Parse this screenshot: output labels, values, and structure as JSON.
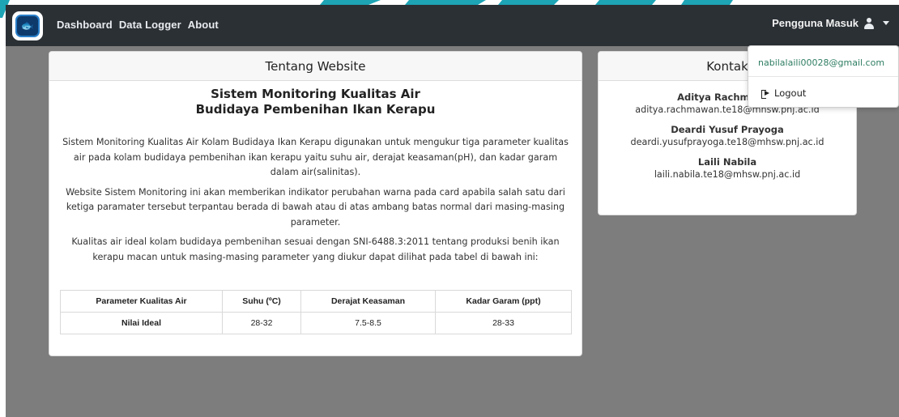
{
  "nav": {
    "items": [
      "Dashboard",
      "Data Logger",
      "About"
    ]
  },
  "user_menu": {
    "label": "Pengguna Masuk",
    "email": "nabilalaili00028@gmail.com",
    "logout": "Logout"
  },
  "about": {
    "header": "Tentang Website",
    "title_line1": "Sistem Monitoring Kualitas Air",
    "title_line2": "Budidaya Pembenihan Ikan Kerapu",
    "paragraph1": "Sistem Monitoring Kualitas Air Kolam Budidaya Ikan Kerapu digunakan untuk mengukur tiga parameter kualitas air pada kolam budidaya pembenihan ikan kerapu yaitu suhu air, derajat keasaman(pH), dan kadar garam dalam air(salinitas).",
    "paragraph2": "Website Sistem Monitoring ini akan memberikan indikator perubahan warna pada card apabila salah satu dari ketiga paramater tersebut terpantau berada di bawah atau di atas ambang batas normal dari masing-masing parameter.",
    "paragraph3": "Kualitas air ideal kolam budidaya pembenihan sesuai dengan SNI-6488.3:2011 tentang produksi benih ikan kerapu macan untuk masing-masing parameter yang diukur dapat dilihat pada tabel di bawah ini:",
    "table": {
      "headers": [
        "Parameter Kualitas Air",
        "Suhu (ºC)",
        "Derajat Keasaman",
        "Kadar Garam (ppt)"
      ],
      "row": [
        "Nilai Ideal",
        "28-32",
        "7.5-8.5",
        "28-33"
      ]
    }
  },
  "contact": {
    "header": "Kontak",
    "people": [
      {
        "name": "Aditya Rachmawan",
        "email": "aditya.rachmawan.te18@mhsw.pnj.ac.id"
      },
      {
        "name": "Deardi Yusuf Prayoga",
        "email": "deardi.yusufprayoga.te18@mhsw.pnj.ac.id"
      },
      {
        "name": "Laili Nabila",
        "email": "laili.nabila.te18@mhsw.pnj.ac.id"
      }
    ]
  },
  "colors": {
    "navbar": "#2b3035",
    "overlay": "#7d7d7d",
    "accent_stripes": "#1da4b5",
    "email_link": "#2e7d63"
  }
}
